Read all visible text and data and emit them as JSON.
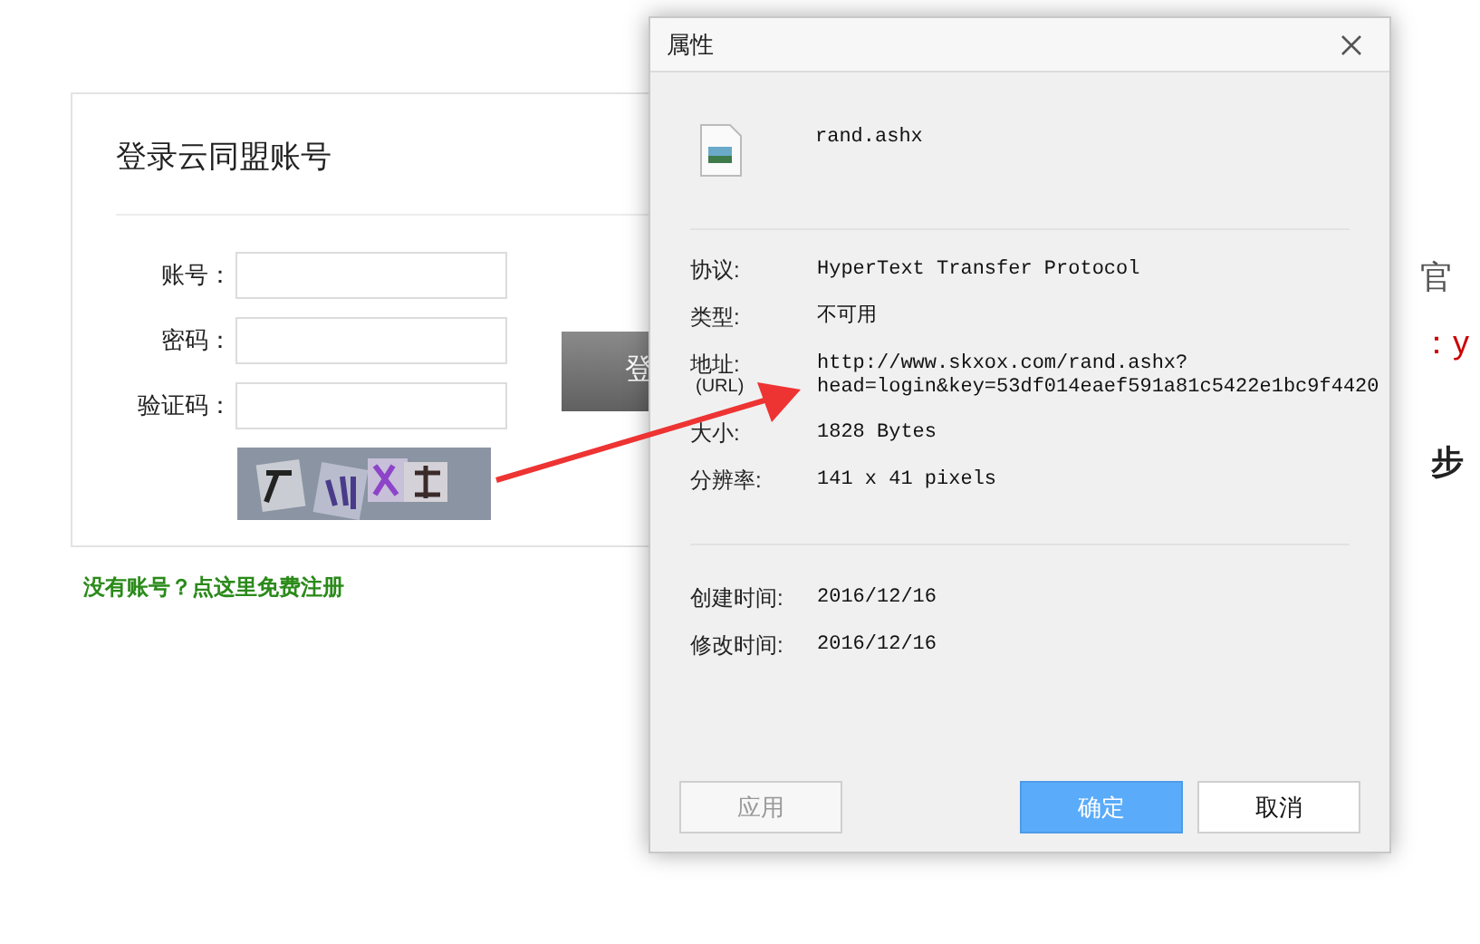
{
  "login": {
    "title": "登录云同盟账号",
    "fields": [
      {
        "label": "账号："
      },
      {
        "label": "密码："
      },
      {
        "label": "验证码："
      }
    ],
    "button": "登",
    "register_link": "没有账号？点这里免费注册"
  },
  "side_text": [
    {
      "text": "官",
      "color": "#555555"
    },
    {
      "text": "：y",
      "color": "#cc0000"
    },
    {
      "text": "步",
      "color": "#222222"
    }
  ],
  "dialog": {
    "title": "属性",
    "file_name": "rand.ashx",
    "details": [
      {
        "label": "协议:",
        "value": "HyperText Transfer Protocol"
      },
      {
        "label": "类型:",
        "value": "不可用"
      },
      {
        "label": "地址:",
        "sublabel": "(URL)",
        "value": "http://www.skxox.com/rand.ashx?",
        "value_2": "head=login&key=53df014eaef591a81c5422e1bc9f4420"
      },
      {
        "label": "大小:",
        "value": "1828 Bytes"
      },
      {
        "label": "分辨率:",
        "value": "141 x 41 pixels"
      }
    ],
    "dates": [
      {
        "label": "创建时间:",
        "value": "2016/12/16"
      },
      {
        "label": "修改时间:",
        "value": "2016/12/16"
      }
    ],
    "buttons": [
      {
        "label": "应用",
        "kind": "secondary",
        "disabled": true
      },
      {
        "label": "确定",
        "kind": "primary",
        "disabled": false
      },
      {
        "label": "取消",
        "kind": "secondary",
        "disabled": false
      }
    ]
  }
}
